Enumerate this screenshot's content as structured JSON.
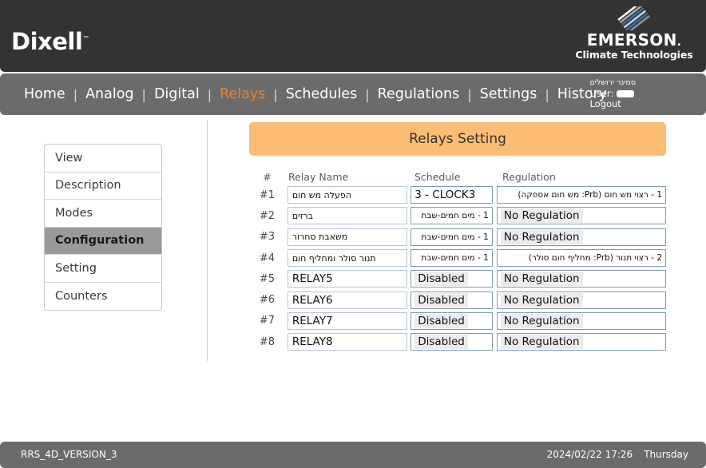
{
  "brand": {
    "dixell": "Dixell",
    "dixell_tm": "™",
    "emerson": "EMERSON",
    "emerson_dot": ".",
    "emerson_sub": "Climate Technologies",
    "accent_orange": "#f08020",
    "panel_orange": "#fbbd73",
    "header_dark": "#333333",
    "bar_gray": "#6b6b6b",
    "selected_gray": "#9a9a9a"
  },
  "nav": {
    "items": [
      {
        "label": "Home",
        "active": false
      },
      {
        "label": "Analog",
        "active": false
      },
      {
        "label": "Digital",
        "active": false
      },
      {
        "label": "Relays",
        "active": true
      },
      {
        "label": "Schedules",
        "active": false
      },
      {
        "label": "Regulations",
        "active": false
      },
      {
        "label": "Settings",
        "active": false
      },
      {
        "label": "History",
        "active": false
      }
    ],
    "separator": "|"
  },
  "user": {
    "site": "סמינר ירושלים",
    "user_label": "User:",
    "user_value": "",
    "logout": "Logout"
  },
  "sidebar": {
    "items": [
      {
        "label": "View",
        "selected": false
      },
      {
        "label": "Description",
        "selected": false
      },
      {
        "label": "Modes",
        "selected": false
      },
      {
        "label": "Configuration",
        "selected": true
      },
      {
        "label": "Setting",
        "selected": false
      },
      {
        "label": "Counters",
        "selected": false
      }
    ]
  },
  "main": {
    "panel_title": "Relays Setting",
    "columns": {
      "num": "#",
      "relay_name": "Relay Name",
      "schedule": "Schedule",
      "regulation": "Regulation"
    },
    "rows": [
      {
        "num": "#1",
        "relay_name": "הפעלה מש חום",
        "name_rtl": true,
        "schedule": "3 - CLOCK3",
        "schedule_rtl": false,
        "schedule_chip": false,
        "regulation": "1 - רצוי מש חום (Prb: מש חום אספקה)",
        "regulation_rtl": true,
        "regulation_chip": false
      },
      {
        "num": "#2",
        "relay_name": "ברזים",
        "name_rtl": true,
        "schedule": "1 - מים חמים-שבת",
        "schedule_rtl": true,
        "schedule_chip": false,
        "regulation": "No Regulation",
        "regulation_rtl": false,
        "regulation_chip": true
      },
      {
        "num": "#3",
        "relay_name": "משאבת סחרור",
        "name_rtl": true,
        "schedule": "1 - מים חמים-שבת",
        "schedule_rtl": true,
        "schedule_chip": false,
        "regulation": "No Regulation",
        "regulation_rtl": false,
        "regulation_chip": true
      },
      {
        "num": "#4",
        "relay_name": "תנור סולר ומחליף חום",
        "name_rtl": true,
        "schedule": "1 - מים חמים-שבת",
        "schedule_rtl": true,
        "schedule_chip": false,
        "regulation": "2 - רצוי תנור (Prb: מחליף חום סולר)",
        "regulation_rtl": true,
        "regulation_chip": false
      },
      {
        "num": "#5",
        "relay_name": "RELAY5",
        "name_rtl": false,
        "schedule": "Disabled",
        "schedule_rtl": false,
        "schedule_chip": true,
        "regulation": "No Regulation",
        "regulation_rtl": false,
        "regulation_chip": true
      },
      {
        "num": "#6",
        "relay_name": "RELAY6",
        "name_rtl": false,
        "schedule": "Disabled",
        "schedule_rtl": false,
        "schedule_chip": true,
        "regulation": "No Regulation",
        "regulation_rtl": false,
        "regulation_chip": true
      },
      {
        "num": "#7",
        "relay_name": "RELAY7",
        "name_rtl": false,
        "schedule": "Disabled",
        "schedule_rtl": false,
        "schedule_chip": true,
        "regulation": "No Regulation",
        "regulation_rtl": false,
        "regulation_chip": true
      },
      {
        "num": "#8",
        "relay_name": "RELAY8",
        "name_rtl": false,
        "schedule": "Disabled",
        "schedule_rtl": false,
        "schedule_chip": true,
        "regulation": "No Regulation",
        "regulation_rtl": false,
        "regulation_chip": true
      }
    ]
  },
  "footer": {
    "version": "RRS_4D_VERSION_3",
    "datetime": "2024/02/22 17:26",
    "weekday": "Thursday"
  }
}
